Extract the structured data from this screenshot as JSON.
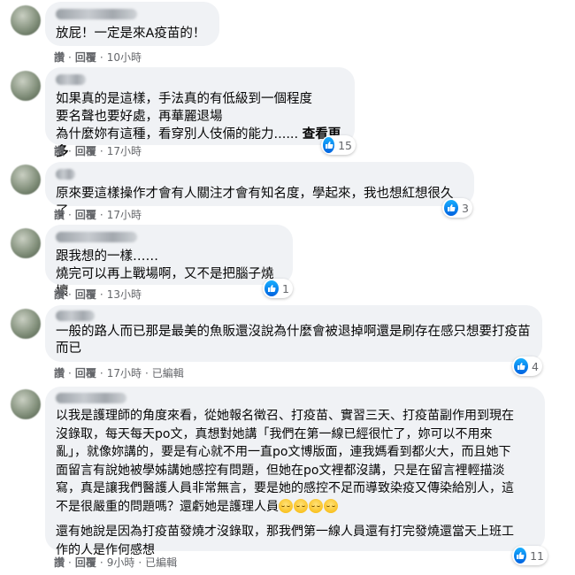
{
  "actions": {
    "like": "讚",
    "reply": "回覆",
    "edited": "已編輯"
  },
  "comments": [
    {
      "lines": "放屁！一定是來A疫苗的！",
      "time": "10小時",
      "edited": false,
      "likes": null
    },
    {
      "lines": "如果真的是這樣，手法真的有低級到一個程度\n要名聲也要好處，再華麗退場\n為什麼妳有這種，看穿別人伎倆的能力......",
      "see_more": "查看更多",
      "time": "17小時",
      "edited": false,
      "likes": "15"
    },
    {
      "lines": "原來要這樣操作才會有人關注才會有知名度，學起來，我也想紅想很久了",
      "time": "17小時",
      "edited": false,
      "likes": "3"
    },
    {
      "lines": "跟我想的一樣……\n燒完可以再上戰場啊，又不是把腦子燒壞",
      "time": "13小時",
      "edited": false,
      "likes": "1"
    },
    {
      "lines": "一般的路人而已那是最美的魚販還沒說為什麼會被退掉啊還是刷存在感只想要打疫苗\n而已",
      "time": "17小時",
      "edited": true,
      "likes": "4"
    },
    {
      "lines": "以我是護理師的角度來看，從她報名徵召、打疫苗、實習三天、打疫苗副作用到現在\n沒錄取，每天每天po文，真想對她講「我們在第一線已經很忙了，妳可以不用來\n亂」，就像妳講的，要是有心就不用一直po文博版面，連我媽看到都火大，而且她下\n面留言有說她被學姊講她感控有問題，但她在po文裡都沒講，只是在留言裡輕描淡\n寫，真是讓我們醫護人員非常無言，要是她的感控不足而導致染疫又傳染給別人，這\n不是很嚴重的問題嗎？還虧她是護理人員",
      "emoji_count": 4,
      "extra": "還有她說是因為打疫苗發燒才沒錄取，那我們第一線人員還有打完發燒還當天上班工\n作的人是作何感想",
      "time": "9小時",
      "edited": true,
      "likes": "11"
    }
  ]
}
